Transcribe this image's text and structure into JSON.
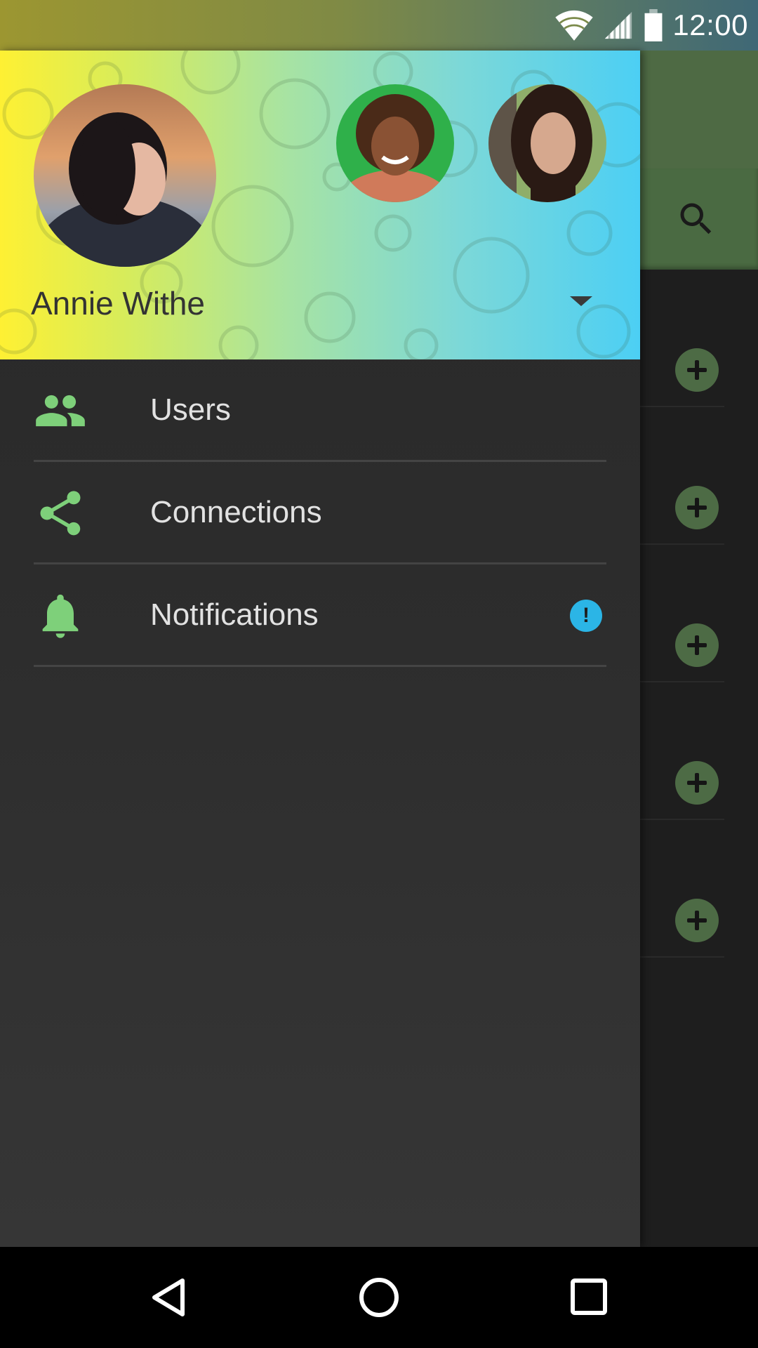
{
  "status_bar": {
    "time": "12:00",
    "icons": [
      "wifi-icon",
      "cell-signal-icon",
      "battery-icon"
    ]
  },
  "drawer": {
    "account": {
      "name": "Annie Withe",
      "dropdown_icon": "arrow-drop-down-icon"
    },
    "menu_items": [
      {
        "label": "Users",
        "icon": "people-icon"
      },
      {
        "label": "Connections",
        "icon": "share-icon"
      },
      {
        "label": "Notifications",
        "icon": "bell-icon",
        "badge": "!"
      }
    ]
  },
  "background_screen": {
    "search_icon": "search-icon",
    "row_icon": "add-circle-icon"
  },
  "nav_bar": {
    "buttons": [
      "back-icon",
      "home-icon",
      "recents-icon"
    ]
  },
  "colors": {
    "accent_green": "#7ed07a",
    "toolbar_green": "#4e6a44",
    "badge_blue": "#2bb5e6",
    "header_gradient": [
      "#fef033",
      "#a7e3a3",
      "#4ccff4"
    ]
  }
}
